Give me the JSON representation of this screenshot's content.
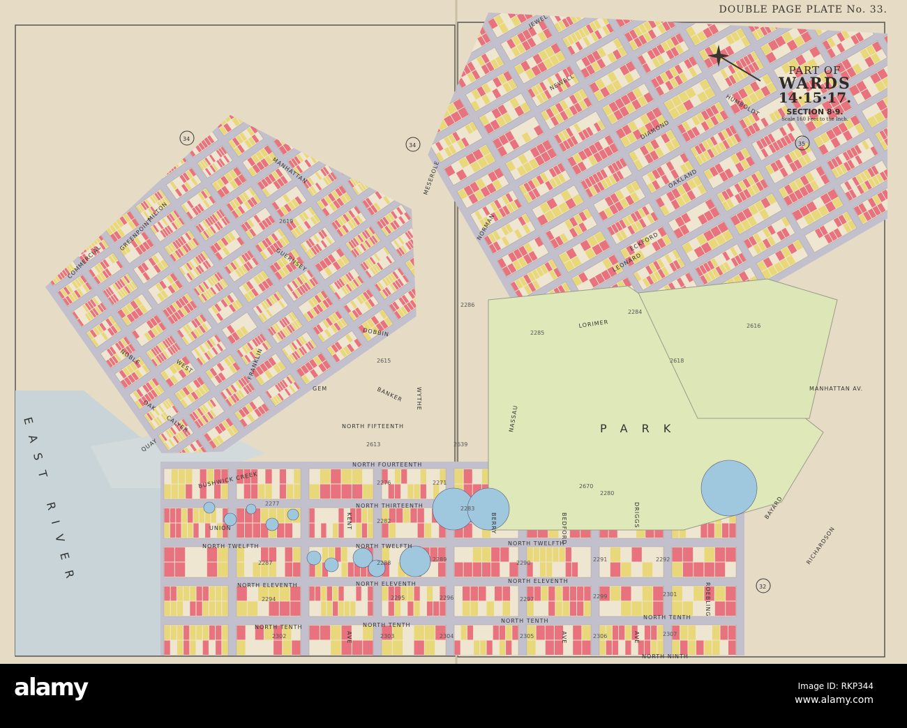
{
  "plate_title": "DOUBLE PAGE PLATE No. 33.",
  "cartouche": {
    "part_of": "PART OF",
    "wards": "WARDS",
    "ward_numbers": "14·15·17.",
    "section": "SECTION 8·9.",
    "scale": "Scale 160 Feet to the Inch."
  },
  "plate_refs": [
    "34",
    "34",
    "35",
    "32"
  ],
  "colors": {
    "paper": "#e6dcc6",
    "brick": "#e8737f",
    "frame": "#e9d87a",
    "street": "#c2c0cc",
    "park": "#dfe8b8",
    "water": "#c9d4d8",
    "tank": "#9fc8de"
  },
  "streets": {
    "north_fourteenth": "NORTH FOURTEENTH",
    "north_thirteenth": "NORTH THIRTEENTH",
    "north_twelfth": "NORTH TWELFTH",
    "north_eleventh": "NORTH ELEVENTH",
    "north_tenth": "NORTH TENTH",
    "north_ninth": "NORTH NINTH",
    "north_fifteenth": "NORTH FIFTEENTH",
    "st": "ST",
    "kent": "KENT",
    "wythe": "WYTHE",
    "berry": "BERRY",
    "bedford": "BEDFORD",
    "driggs": "DRIGGS",
    "roebling": "ROEBLING",
    "ave": "AVE",
    "bayard": "BAYARD",
    "richardson": "RICHARDSON",
    "manhattan_av": "MANHATTAN AV.",
    "lorimer": "LORIMER",
    "leonard": "LEONARD",
    "eckford": "ECKFORD",
    "oakland": "OAKLAND",
    "diamond": "DIAMOND",
    "newell": "NEWELL",
    "jewel": "JEWEL",
    "humboldt": "HUMBOLDT",
    "guernsey": "GUERNSEY",
    "norman": "NORMAN",
    "nassau": "NASSAU",
    "meserole": "MESEROLE",
    "dobbin": "DOBBIN",
    "banker": "BANKER",
    "gem": "GEM",
    "calyer": "CALYER",
    "quay": "QUAY",
    "oak": "OAK",
    "noble": "NOBLE",
    "milton": "MILTON",
    "greenpoint": "GREENPOINT",
    "commercial": "COMMERCIAL",
    "west": "WEST",
    "franklin": "FRANKLIN",
    "manhattan": "MANHATTAN",
    "union": "UNION",
    "bushwick_creek": "BUSHWICK  CREEK",
    "east_river": "EAST RIVER",
    "park": "PARK"
  },
  "block_numbers": [
    "2276",
    "2271",
    "2283",
    "2277",
    "2282",
    "2287",
    "2288",
    "2289",
    "2290",
    "2291",
    "2292",
    "2294",
    "2295",
    "2296",
    "2297",
    "2299",
    "2301",
    "2302",
    "2303",
    "2304",
    "2305",
    "2306",
    "2307",
    "2670",
    "2613",
    "2639",
    "2615",
    "2619",
    "2286",
    "2285",
    "2284",
    "2280",
    "2616",
    "2618"
  ],
  "footer": {
    "logo": "alamy",
    "image_id": "Image ID: RKP344",
    "url": "www.alamy.com"
  }
}
